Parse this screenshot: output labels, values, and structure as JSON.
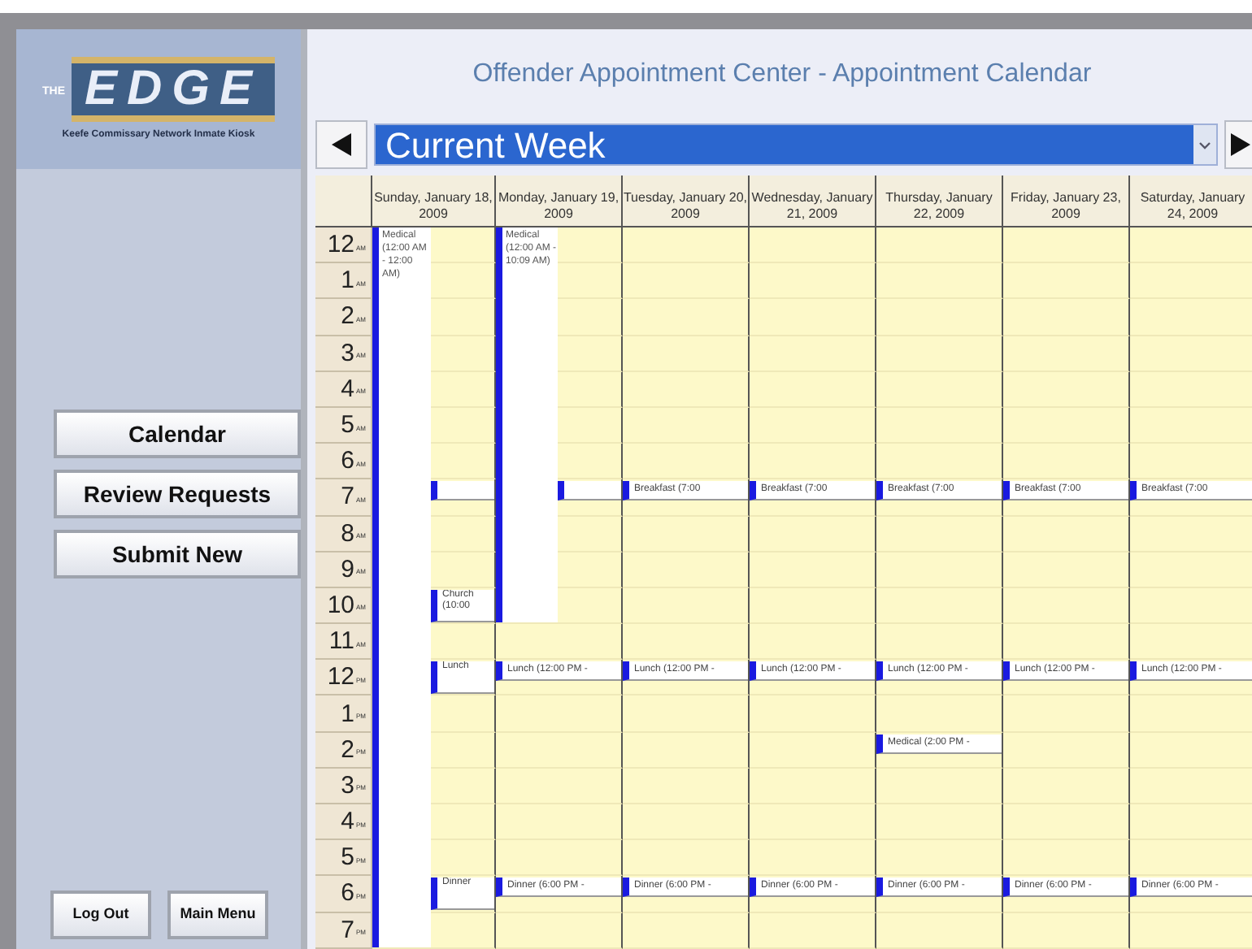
{
  "logo": {
    "top": "THE",
    "main": "EDGE",
    "subtitle": "Keefe Commissary Network Inmate Kiosk"
  },
  "nav_buttons": [
    {
      "label": "Calendar"
    },
    {
      "label": "Review Requests"
    },
    {
      "label": "Submit New"
    }
  ],
  "footer_buttons": [
    {
      "label": "Log Out"
    },
    {
      "label": "Main Menu"
    }
  ],
  "title": "Offender Appointment Center - Appointment Calendar",
  "week_select": {
    "value": "Current Week"
  },
  "days": [
    "Sunday, January 18, 2009",
    "Monday, January 19, 2009",
    "Tuesday, January 20, 2009",
    "Wednesday, January 21, 2009",
    "Thursday, January 22, 2009",
    "Friday, January 23, 2009",
    "Saturday, January 24, 2009"
  ],
  "rows": [
    {
      "hour": "12",
      "period": "AM",
      "cells": [
        [
          {
            "kind": "start",
            "text": "Medical (12:00 AM - 12:00 AM)"
          },
          {
            "kind": "empty"
          }
        ],
        [
          {
            "kind": "start",
            "text": "Medical (12:00 AM - 10:09 AM)"
          },
          {
            "kind": "empty"
          }
        ],
        [
          {
            "kind": "empty"
          }
        ],
        [
          {
            "kind": "empty"
          }
        ],
        [
          {
            "kind": "empty"
          }
        ],
        [
          {
            "kind": "empty"
          }
        ],
        [
          {
            "kind": "empty"
          }
        ]
      ]
    },
    {
      "hour": "1",
      "period": "AM",
      "cells": [
        [
          {
            "kind": "continued"
          },
          {
            "kind": "empty"
          }
        ],
        [
          {
            "kind": "continued"
          },
          {
            "kind": "empty"
          }
        ],
        [
          {
            "kind": "empty"
          }
        ],
        [
          {
            "kind": "empty"
          }
        ],
        [
          {
            "kind": "empty"
          }
        ],
        [
          {
            "kind": "empty"
          }
        ],
        [
          {
            "kind": "empty"
          }
        ]
      ]
    },
    {
      "hour": "2",
      "period": "AM",
      "cells": [
        [
          {
            "kind": "continued"
          },
          {
            "kind": "empty"
          }
        ],
        [
          {
            "kind": "continued"
          },
          {
            "kind": "empty"
          }
        ],
        [
          {
            "kind": "empty"
          }
        ],
        [
          {
            "kind": "empty"
          }
        ],
        [
          {
            "kind": "empty"
          }
        ],
        [
          {
            "kind": "empty"
          }
        ],
        [
          {
            "kind": "empty"
          }
        ]
      ]
    },
    {
      "hour": "3",
      "period": "AM",
      "cells": [
        [
          {
            "kind": "continued"
          },
          {
            "kind": "empty"
          }
        ],
        [
          {
            "kind": "continued"
          },
          {
            "kind": "empty"
          }
        ],
        [
          {
            "kind": "empty"
          }
        ],
        [
          {
            "kind": "empty"
          }
        ],
        [
          {
            "kind": "empty"
          }
        ],
        [
          {
            "kind": "empty"
          }
        ],
        [
          {
            "kind": "empty"
          }
        ]
      ]
    },
    {
      "hour": "4",
      "period": "AM",
      "cells": [
        [
          {
            "kind": "continued"
          },
          {
            "kind": "empty"
          }
        ],
        [
          {
            "kind": "continued"
          },
          {
            "kind": "empty"
          }
        ],
        [
          {
            "kind": "empty"
          }
        ],
        [
          {
            "kind": "empty"
          }
        ],
        [
          {
            "kind": "empty"
          }
        ],
        [
          {
            "kind": "empty"
          }
        ],
        [
          {
            "kind": "empty"
          }
        ]
      ]
    },
    {
      "hour": "5",
      "period": "AM",
      "cells": [
        [
          {
            "kind": "continued"
          },
          {
            "kind": "empty"
          }
        ],
        [
          {
            "kind": "continued"
          },
          {
            "kind": "empty"
          }
        ],
        [
          {
            "kind": "empty"
          }
        ],
        [
          {
            "kind": "empty"
          }
        ],
        [
          {
            "kind": "empty"
          }
        ],
        [
          {
            "kind": "empty"
          }
        ],
        [
          {
            "kind": "empty"
          }
        ]
      ]
    },
    {
      "hour": "6",
      "period": "AM",
      "cells": [
        [
          {
            "kind": "continued"
          },
          {
            "kind": "empty"
          }
        ],
        [
          {
            "kind": "continued"
          },
          {
            "kind": "empty"
          }
        ],
        [
          {
            "kind": "empty"
          }
        ],
        [
          {
            "kind": "empty"
          }
        ],
        [
          {
            "kind": "empty"
          }
        ],
        [
          {
            "kind": "empty"
          }
        ],
        [
          {
            "kind": "empty"
          }
        ]
      ]
    },
    {
      "hour": "7",
      "period": "AM",
      "cells": [
        [
          {
            "kind": "continued"
          },
          {
            "kind": "start"
          }
        ],
        [
          {
            "kind": "continued"
          },
          {
            "kind": "start"
          }
        ],
        [
          {
            "kind": "start",
            "text": "Breakfast (7:00"
          }
        ],
        [
          {
            "kind": "start",
            "text": "Breakfast (7:00"
          }
        ],
        [
          {
            "kind": "start",
            "text": "Breakfast (7:00"
          }
        ],
        [
          {
            "kind": "start",
            "text": "Breakfast (7:00"
          }
        ],
        [
          {
            "kind": "start",
            "text": "Breakfast (7:00"
          }
        ]
      ]
    },
    {
      "hour": "8",
      "period": "AM",
      "cells": [
        [
          {
            "kind": "continued"
          },
          {
            "kind": "empty"
          }
        ],
        [
          {
            "kind": "continued"
          },
          {
            "kind": "empty"
          }
        ],
        [
          {
            "kind": "empty"
          }
        ],
        [
          {
            "kind": "empty"
          }
        ],
        [
          {
            "kind": "empty"
          }
        ],
        [
          {
            "kind": "empty"
          }
        ],
        [
          {
            "kind": "empty"
          }
        ]
      ]
    },
    {
      "hour": "9",
      "period": "AM",
      "cells": [
        [
          {
            "kind": "continued"
          },
          {
            "kind": "empty"
          }
        ],
        [
          {
            "kind": "continued"
          },
          {
            "kind": "empty"
          }
        ],
        [
          {
            "kind": "empty"
          }
        ],
        [
          {
            "kind": "empty"
          }
        ],
        [
          {
            "kind": "empty"
          }
        ],
        [
          {
            "kind": "empty"
          }
        ],
        [
          {
            "kind": "empty"
          }
        ]
      ]
    },
    {
      "hour": "10",
      "period": "AM",
      "cells": [
        [
          {
            "kind": "continued"
          },
          {
            "kind": "start",
            "text": "Church (10:00"
          }
        ],
        [
          {
            "kind": "continued"
          },
          {
            "kind": "empty"
          }
        ],
        [
          {
            "kind": "empty"
          }
        ],
        [
          {
            "kind": "empty"
          }
        ],
        [
          {
            "kind": "empty"
          }
        ],
        [
          {
            "kind": "empty"
          }
        ],
        [
          {
            "kind": "empty"
          }
        ]
      ]
    },
    {
      "hour": "11",
      "period": "AM",
      "cells": [
        [
          {
            "kind": "continued"
          },
          {
            "kind": "empty"
          }
        ],
        [
          {
            "kind": "empty"
          }
        ],
        [
          {
            "kind": "empty"
          }
        ],
        [
          {
            "kind": "empty"
          }
        ],
        [
          {
            "kind": "empty"
          }
        ],
        [
          {
            "kind": "empty"
          }
        ],
        [
          {
            "kind": "empty"
          }
        ]
      ]
    },
    {
      "hour": "12",
      "period": "PM",
      "cells": [
        [
          {
            "kind": "continued"
          },
          {
            "kind": "start",
            "text": "Lunch"
          }
        ],
        [
          {
            "kind": "start",
            "text": "Lunch (12:00 PM -"
          }
        ],
        [
          {
            "kind": "start",
            "text": "Lunch (12:00 PM -"
          }
        ],
        [
          {
            "kind": "start",
            "text": "Lunch (12:00 PM -"
          }
        ],
        [
          {
            "kind": "start",
            "text": "Lunch (12:00 PM -"
          }
        ],
        [
          {
            "kind": "start",
            "text": "Lunch (12:00 PM -"
          }
        ],
        [
          {
            "kind": "start",
            "text": "Lunch (12:00 PM -"
          }
        ]
      ]
    },
    {
      "hour": "1",
      "period": "PM",
      "cells": [
        [
          {
            "kind": "continued"
          },
          {
            "kind": "empty"
          }
        ],
        [
          {
            "kind": "empty"
          }
        ],
        [
          {
            "kind": "empty"
          }
        ],
        [
          {
            "kind": "empty"
          }
        ],
        [
          {
            "kind": "empty"
          }
        ],
        [
          {
            "kind": "empty"
          }
        ],
        [
          {
            "kind": "empty"
          }
        ]
      ]
    },
    {
      "hour": "2",
      "period": "PM",
      "cells": [
        [
          {
            "kind": "continued"
          },
          {
            "kind": "empty"
          }
        ],
        [
          {
            "kind": "empty"
          }
        ],
        [
          {
            "kind": "empty"
          }
        ],
        [
          {
            "kind": "empty"
          }
        ],
        [
          {
            "kind": "start",
            "text": "Medical (2:00 PM -"
          }
        ],
        [
          {
            "kind": "empty"
          }
        ],
        [
          {
            "kind": "empty"
          }
        ]
      ]
    },
    {
      "hour": "3",
      "period": "PM",
      "cells": [
        [
          {
            "kind": "continued"
          },
          {
            "kind": "empty"
          }
        ],
        [
          {
            "kind": "empty"
          }
        ],
        [
          {
            "kind": "empty"
          }
        ],
        [
          {
            "kind": "empty"
          }
        ],
        [
          {
            "kind": "empty"
          }
        ],
        [
          {
            "kind": "empty"
          }
        ],
        [
          {
            "kind": "empty"
          }
        ]
      ]
    },
    {
      "hour": "4",
      "period": "PM",
      "cells": [
        [
          {
            "kind": "continued"
          },
          {
            "kind": "empty"
          }
        ],
        [
          {
            "kind": "empty"
          }
        ],
        [
          {
            "kind": "empty"
          }
        ],
        [
          {
            "kind": "empty"
          }
        ],
        [
          {
            "kind": "empty"
          }
        ],
        [
          {
            "kind": "empty"
          }
        ],
        [
          {
            "kind": "empty"
          }
        ]
      ]
    },
    {
      "hour": "5",
      "period": "PM",
      "cells": [
        [
          {
            "kind": "continued"
          },
          {
            "kind": "empty"
          }
        ],
        [
          {
            "kind": "empty"
          }
        ],
        [
          {
            "kind": "empty"
          }
        ],
        [
          {
            "kind": "empty"
          }
        ],
        [
          {
            "kind": "empty"
          }
        ],
        [
          {
            "kind": "empty"
          }
        ],
        [
          {
            "kind": "empty"
          }
        ]
      ]
    },
    {
      "hour": "6",
      "period": "PM",
      "cells": [
        [
          {
            "kind": "continued"
          },
          {
            "kind": "start",
            "text": "Dinner"
          }
        ],
        [
          {
            "kind": "start",
            "text": "Dinner (6:00 PM -"
          }
        ],
        [
          {
            "kind": "start",
            "text": "Dinner (6:00 PM -"
          }
        ],
        [
          {
            "kind": "start",
            "text": "Dinner (6:00 PM -"
          }
        ],
        [
          {
            "kind": "start",
            "text": "Dinner (6:00 PM -"
          }
        ],
        [
          {
            "kind": "start",
            "text": "Dinner (6:00 PM -"
          }
        ],
        [
          {
            "kind": "start",
            "text": "Dinner (6:00 PM -"
          }
        ]
      ]
    },
    {
      "hour": "7",
      "period": "PM",
      "cells": [
        [
          {
            "kind": "continued"
          },
          {
            "kind": "empty"
          }
        ],
        [
          {
            "kind": "empty"
          }
        ],
        [
          {
            "kind": "empty"
          }
        ],
        [
          {
            "kind": "empty"
          }
        ],
        [
          {
            "kind": "empty"
          }
        ],
        [
          {
            "kind": "empty"
          }
        ],
        [
          {
            "kind": "empty"
          }
        ]
      ]
    }
  ]
}
